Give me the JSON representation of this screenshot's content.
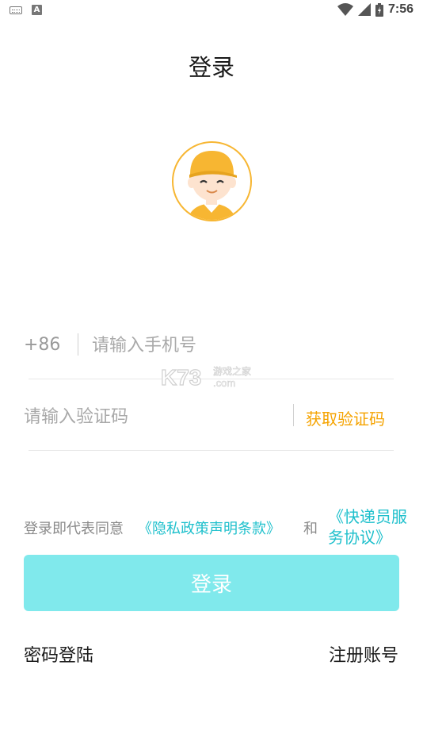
{
  "status_bar": {
    "time": "7:56",
    "left_icons": [
      "keyboard-icon",
      "a-notification-icon"
    ],
    "right_icons": [
      "wifi-icon",
      "signal-icon",
      "battery-icon"
    ]
  },
  "title": "登录",
  "avatar": {
    "icon": "courier-avatar-icon",
    "accent_color": "#f7b632"
  },
  "phone": {
    "country_code": "+86",
    "value": "",
    "placeholder": "请输入手机号"
  },
  "code": {
    "value": "",
    "placeholder": "请输入验证码",
    "get_code_label": "获取验证码",
    "get_code_color": "#f5a300"
  },
  "watermark": {
    "brand": "K73",
    "subtitle": "游戏之家",
    "domain": ".com"
  },
  "agreement": {
    "prefix": "登录即代表同意",
    "privacy_link": "《隐私政策声明条款》",
    "and": "和",
    "service_link": "《快递员服务协议》",
    "link_color": "#1fc0cc"
  },
  "login_button": {
    "label": "登录",
    "color": "#80e9ec"
  },
  "footer": {
    "password_login": "密码登陆",
    "register": "注册账号"
  }
}
